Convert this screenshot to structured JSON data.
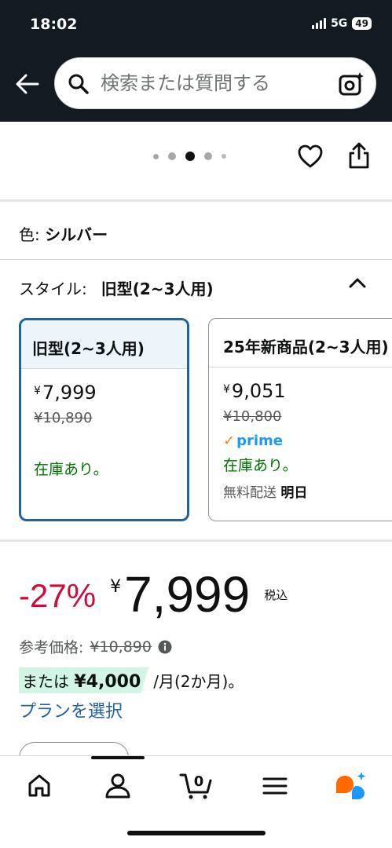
{
  "status": {
    "time": "18:02",
    "network": "5G",
    "battery": "49"
  },
  "search": {
    "placeholder": "検索または質問する"
  },
  "product": {
    "color_label": "色:",
    "color_value": "シルバー",
    "style_label": "スタイル:",
    "style_value": "旧型(2~3人用)"
  },
  "options": [
    {
      "title": "旧型(2~3人用)",
      "price": "7,999",
      "list_price": "¥10,890",
      "stock": "在庫あり。",
      "selected": true
    },
    {
      "title": "25年新商品(2~3人用)",
      "price": "9,051",
      "list_price": "¥10,800",
      "prime": "prime",
      "stock": "在庫あり。",
      "delivery_label": "無料配送",
      "delivery_day": "明日",
      "selected": false
    }
  ],
  "pricing": {
    "discount": "-27%",
    "yen": "¥",
    "price": "7,999",
    "tax_label": "税込",
    "ref_label": "参考価格:",
    "ref_price": "¥10,890",
    "installment_prefix": "または",
    "installment_amount": "¥4,000",
    "installment_suffix": "/月(2か月)。",
    "plan_link": "プランを選択"
  },
  "carousel": {
    "count": 5,
    "active_index": 2
  },
  "tabbar": {
    "cart_count": "0"
  },
  "colors": {
    "header_bg": "#131a22",
    "accent_blue": "#2162a1",
    "discount_red": "#cc0c39",
    "stock_green": "#007600"
  }
}
